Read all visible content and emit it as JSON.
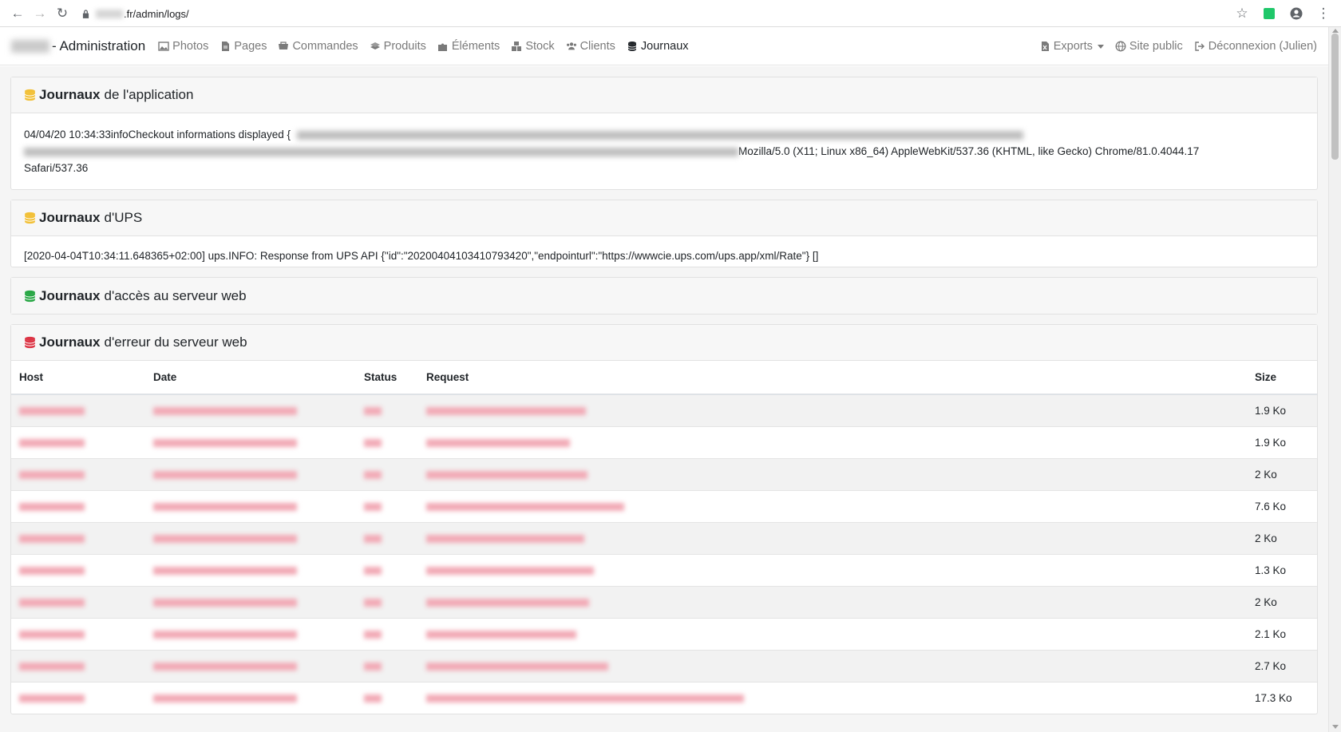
{
  "browser": {
    "url_path": ".fr/admin/logs/"
  },
  "navbar": {
    "brand_suffix": "- Administration",
    "items": [
      {
        "label": "Photos",
        "icon": "image-icon"
      },
      {
        "label": "Pages",
        "icon": "file-icon"
      },
      {
        "label": "Commandes",
        "icon": "cart-icon"
      },
      {
        "label": "Produits",
        "icon": "boxes-icon"
      },
      {
        "label": "Éléments",
        "icon": "puzzle-icon"
      },
      {
        "label": "Stock",
        "icon": "cubes-icon"
      },
      {
        "label": "Clients",
        "icon": "users-icon"
      },
      {
        "label": "Journaux",
        "icon": "database-icon",
        "active": true
      }
    ],
    "right_items": [
      {
        "label": "Exports",
        "icon": "file-excel-icon"
      },
      {
        "label": "Site public",
        "icon": "globe-icon"
      },
      {
        "label": "Déconnexion (Julien)",
        "icon": "sign-out-icon"
      }
    ]
  },
  "cards": {
    "app": {
      "title_bold": "Journaux",
      "title_rest": "de l'application",
      "icon_color": "#f2c037",
      "line_start": "04/04/20 10:34:33infoCheckout informations displayed {",
      "line_end": "Mozilla/5.0 (X11; Linux x86_64) AppleWebKit/537.36 (KHTML, like Gecko) Chrome/81.0.4044.17",
      "line_last": "Safari/537.36"
    },
    "ups": {
      "title_bold": "Journaux",
      "title_rest": "d'UPS",
      "icon_color": "#f2c037",
      "line": "[2020-04-04T10:34:11.648365+02:00] ups.INFO: Response from UPS API {\"id\":\"20200404103410793420\",\"endpointurl\":\"https://wwwcie.ups.com/ups.app/xml/Rate\"} []"
    },
    "access": {
      "title_bold": "Journaux",
      "title_rest": "d'accès au serveur web",
      "icon_color": "#28a745"
    },
    "error": {
      "title_bold": "Journaux",
      "title_rest": "d'erreur du serveur web",
      "icon_color": "#dc3545",
      "columns": [
        "Host",
        "Date",
        "Status",
        "Request",
        "Size"
      ],
      "rows": [
        {
          "size": "1.9 Ko"
        },
        {
          "size": "1.9 Ko"
        },
        {
          "size": "2 Ko"
        },
        {
          "size": "7.6 Ko"
        },
        {
          "size": "2 Ko"
        },
        {
          "size": "1.3 Ko"
        },
        {
          "size": "2 Ko"
        },
        {
          "size": "2.1 Ko"
        },
        {
          "size": "2.7 Ko"
        },
        {
          "size": "17.3 Ko"
        }
      ]
    }
  }
}
